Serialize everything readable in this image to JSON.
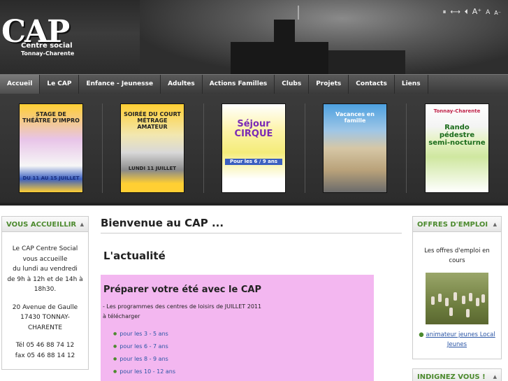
{
  "header": {
    "logo_main": "CAP",
    "logo_sub": "Centre social",
    "logo_town": "Tonnay-Charente",
    "tools": [
      "⏸",
      "⟷",
      "⏴",
      "A⁺",
      "A",
      "A⁻"
    ]
  },
  "nav": {
    "items": [
      {
        "label": "Accueil"
      },
      {
        "label": "Le CAP"
      },
      {
        "label": "Enfance - Jeunesse"
      },
      {
        "label": "Adultes"
      },
      {
        "label": "Actions Familles"
      },
      {
        "label": "Clubs"
      },
      {
        "label": "Projets"
      },
      {
        "label": "Contacts"
      },
      {
        "label": "Liens"
      }
    ]
  },
  "gallery": {
    "posters": [
      {
        "title": "STAGE DE THÉÂTRE D'IMPRO",
        "caption": "DU 11 AU 15 JUILLET"
      },
      {
        "title": "SOIRÉE DU COURT MÉTRAGE AMATEUR",
        "caption": "LUNDI 11 JUILLET"
      },
      {
        "title": "Séjour CIRQUE",
        "caption": "Pour les 6 / 9 ans"
      },
      {
        "title": "Vacances en famille",
        "caption": ""
      },
      {
        "title": "Rando pédestre semi-nocturne",
        "caption": "Tonnay-Charente"
      }
    ]
  },
  "left_box": {
    "title": "VOUS ACCUEILLIR",
    "lines1": [
      "Le CAP Centre Social",
      "vous accueille",
      "du lundi au vendredi",
      "de 9h à 12h et de 14h à",
      "18h30."
    ],
    "lines2": [
      "20 Avenue de Gaulle",
      "17430 TONNAY-",
      "CHARENTE"
    ],
    "lines3": [
      "Tél 05 46 88 74 12",
      "fax 05 46 88 14 12"
    ]
  },
  "main": {
    "title": "Bienvenue au CAP ...",
    "section": "L'actualité",
    "feature_title": "Préparer votre été avec le CAP",
    "feature_lead1": "- Les programmes des centres de loisirs de JUILLET 2011",
    "feature_lead2": "à télécharger",
    "links": [
      "pour les 3 - 5 ans",
      "pour les 6 - 7 ans",
      "pour les 8 - 9  ans",
      "pour les 10 - 12 ans"
    ]
  },
  "right_box": {
    "title": "OFFRES D'EMPLOI",
    "text1": "Les offres d'emploi en",
    "text2": "cours",
    "link1": "animateur jeunes Local",
    "link2": "Jeunes"
  },
  "right_box2": {
    "title": "INDIGNEZ VOUS !"
  },
  "colors": {
    "accent_green": "#4c8a2e",
    "link_blue": "#2a55a5",
    "feature_pink": "#f3b7f0"
  }
}
